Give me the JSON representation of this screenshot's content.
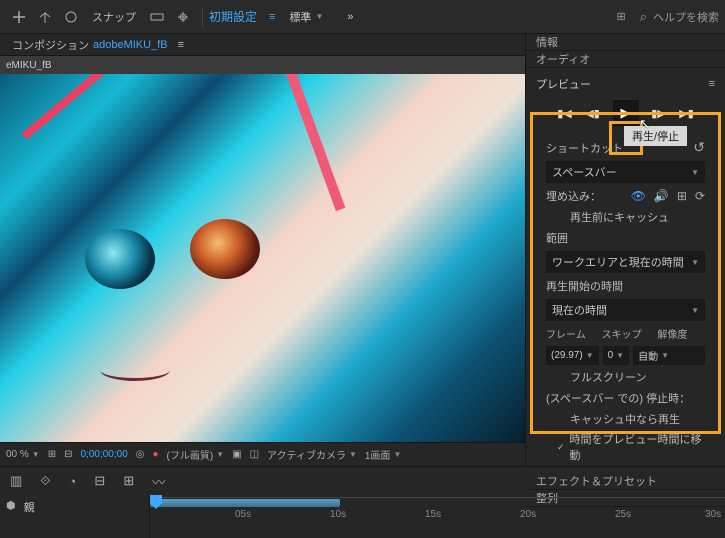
{
  "topbar": {
    "snap_label": "スナップ",
    "preset_link": "初期設定",
    "standard_label": "標準",
    "search_placeholder": "ヘルプを検索"
  },
  "comp": {
    "label": "コンポジション",
    "name": "adobeMIKU_fB",
    "sub_tab": "eMIKU_fB"
  },
  "viewer_footer": {
    "zoom": "00 %",
    "timecode": "0;00;00;00",
    "quality": "(フル画質)",
    "camera": "アクティブカメラ",
    "views": "1画面"
  },
  "panels": {
    "info": "情報",
    "audio": "オーディオ",
    "preview": "プレビュー",
    "effects": "エフェクト＆プリセット",
    "align": "整列"
  },
  "preview": {
    "tooltip": "再生/停止",
    "shortcut_label": "ショートカット",
    "shortcut_value": "スペースバー",
    "include_label": "埋め込み：",
    "cache_before": "再生前にキャッシュ",
    "range_label": "範囲",
    "range_value": "ワークエリアと現在の時間",
    "playfrom_label": "再生開始の時間",
    "playfrom_value": "現在の時間",
    "frame_label": "フレーム",
    "skip_label": "スキップ",
    "res_label": "解像度",
    "frame_value": "(29.97)",
    "skip_value": "0",
    "res_value": "自動",
    "fullscreen": "フルスクリーン",
    "on_stop_label": "(スペースバー での) 停止時：",
    "opt1": "キャッシュ中なら再生",
    "opt2": "時間をプレビュー時間に移動"
  },
  "timeline": {
    "parent": "親",
    "ticks": [
      "05s",
      "10s",
      "15s",
      "20s",
      "25s",
      "30s"
    ]
  }
}
